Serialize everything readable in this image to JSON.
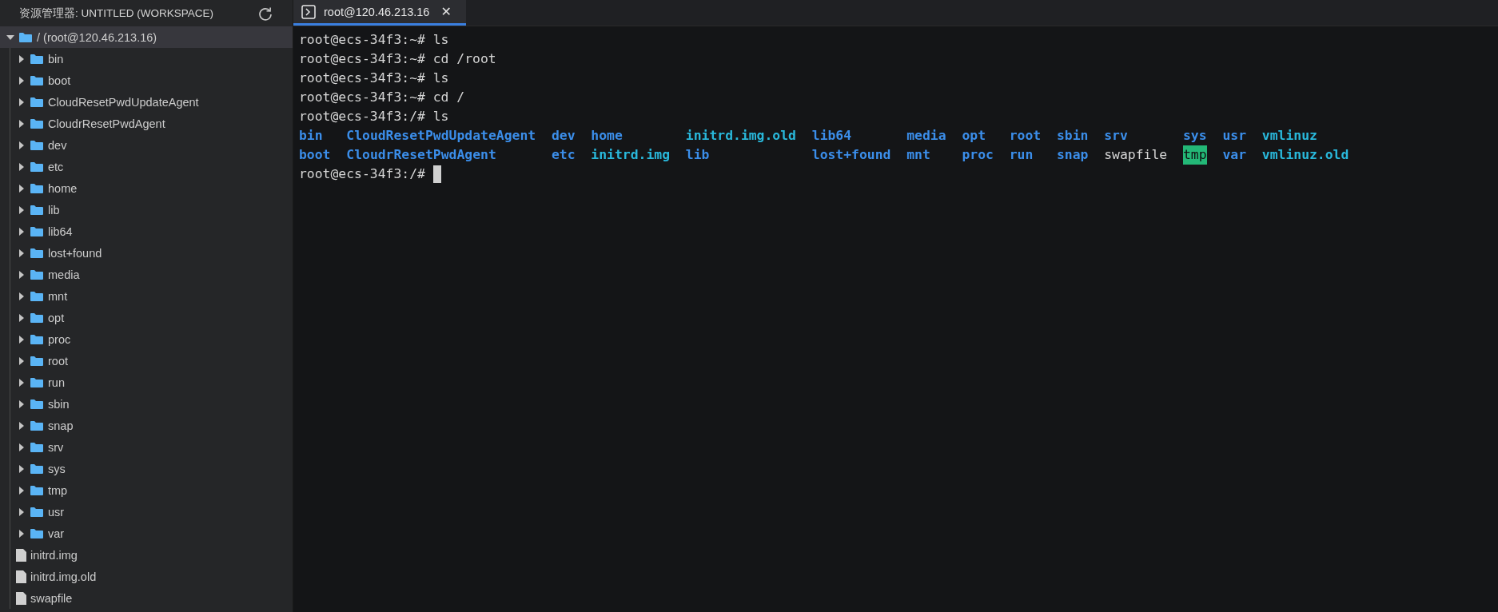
{
  "sidebar": {
    "title": "资源管理器: UNTITLED (WORKSPACE)",
    "tree": [
      {
        "label": "/ (root@120.46.213.16)",
        "kind": "folder",
        "expanded": true,
        "selected": true,
        "children": [
          {
            "label": "bin",
            "kind": "folder",
            "expanded": false,
            "selected": false
          },
          {
            "label": "boot",
            "kind": "folder",
            "expanded": false,
            "selected": false
          },
          {
            "label": "CloudResetPwdUpdateAgent",
            "kind": "folder",
            "expanded": false,
            "selected": false
          },
          {
            "label": "CloudrResetPwdAgent",
            "kind": "folder",
            "expanded": false,
            "selected": false
          },
          {
            "label": "dev",
            "kind": "folder",
            "expanded": false,
            "selected": false
          },
          {
            "label": "etc",
            "kind": "folder",
            "expanded": false,
            "selected": false
          },
          {
            "label": "home",
            "kind": "folder",
            "expanded": false,
            "selected": false
          },
          {
            "label": "lib",
            "kind": "folder",
            "expanded": false,
            "selected": false
          },
          {
            "label": "lib64",
            "kind": "folder",
            "expanded": false,
            "selected": false
          },
          {
            "label": "lost+found",
            "kind": "folder",
            "expanded": false,
            "selected": false
          },
          {
            "label": "media",
            "kind": "folder",
            "expanded": false,
            "selected": false
          },
          {
            "label": "mnt",
            "kind": "folder",
            "expanded": false,
            "selected": false
          },
          {
            "label": "opt",
            "kind": "folder",
            "expanded": false,
            "selected": false
          },
          {
            "label": "proc",
            "kind": "folder",
            "expanded": false,
            "selected": false
          },
          {
            "label": "root",
            "kind": "folder",
            "expanded": false,
            "selected": false
          },
          {
            "label": "run",
            "kind": "folder",
            "expanded": false,
            "selected": false
          },
          {
            "label": "sbin",
            "kind": "folder",
            "expanded": false,
            "selected": false
          },
          {
            "label": "snap",
            "kind": "folder",
            "expanded": false,
            "selected": false
          },
          {
            "label": "srv",
            "kind": "folder",
            "expanded": false,
            "selected": false
          },
          {
            "label": "sys",
            "kind": "folder",
            "expanded": false,
            "selected": false
          },
          {
            "label": "tmp",
            "kind": "folder",
            "expanded": false,
            "selected": false
          },
          {
            "label": "usr",
            "kind": "folder",
            "expanded": false,
            "selected": false
          },
          {
            "label": "var",
            "kind": "folder",
            "expanded": false,
            "selected": false
          },
          {
            "label": "initrd.img",
            "kind": "file",
            "selected": false
          },
          {
            "label": "initrd.img.old",
            "kind": "file",
            "selected": false
          },
          {
            "label": "swapfile",
            "kind": "file",
            "selected": false
          }
        ]
      }
    ]
  },
  "tabs": [
    {
      "label": "root@120.46.213.16",
      "selected": true,
      "close": "✕"
    }
  ],
  "terminal": {
    "lines": [
      {
        "prompt": "root@ecs-34f3:~# ",
        "command": "ls"
      },
      {
        "prompt": "root@ecs-34f3:~# ",
        "command": "cd /root"
      },
      {
        "prompt": "root@ecs-34f3:~# ",
        "command": "ls"
      },
      {
        "prompt": "root@ecs-34f3:~# ",
        "command": "cd /"
      },
      {
        "prompt": "root@ecs-34f3:/# ",
        "command": "ls"
      }
    ],
    "ls_output": [
      [
        {
          "text": "bin",
          "kind": "dir"
        },
        {
          "text": "CloudResetPwdUpdateAgent",
          "kind": "dir"
        },
        {
          "text": "dev",
          "kind": "dir"
        },
        {
          "text": "home",
          "kind": "dir"
        },
        {
          "text": "initrd.img.old",
          "kind": "link"
        },
        {
          "text": "lib64",
          "kind": "dir"
        },
        {
          "text": "media",
          "kind": "dir"
        },
        {
          "text": "opt",
          "kind": "dir"
        },
        {
          "text": "root",
          "kind": "dir"
        },
        {
          "text": "sbin",
          "kind": "dir"
        },
        {
          "text": "srv",
          "kind": "dir"
        },
        {
          "text": "sys",
          "kind": "dir"
        },
        {
          "text": "usr",
          "kind": "dir"
        },
        {
          "text": "vmlinuz",
          "kind": "link"
        }
      ],
      [
        {
          "text": "boot",
          "kind": "dir"
        },
        {
          "text": "CloudrResetPwdAgent",
          "kind": "dir"
        },
        {
          "text": "etc",
          "kind": "dir"
        },
        {
          "text": "initrd.img",
          "kind": "link"
        },
        {
          "text": "lib",
          "kind": "dir"
        },
        {
          "text": "lost+found",
          "kind": "dir"
        },
        {
          "text": "mnt",
          "kind": "dir"
        },
        {
          "text": "proc",
          "kind": "dir"
        },
        {
          "text": "run",
          "kind": "dir"
        },
        {
          "text": "snap",
          "kind": "dir"
        },
        {
          "text": "swapfile",
          "kind": "file"
        },
        {
          "text": "tmp",
          "kind": "sticky"
        },
        {
          "text": "var",
          "kind": "dir"
        },
        {
          "text": "vmlinuz.old",
          "kind": "link"
        }
      ]
    ],
    "current_prompt": "root@ecs-34f3:/# "
  }
}
